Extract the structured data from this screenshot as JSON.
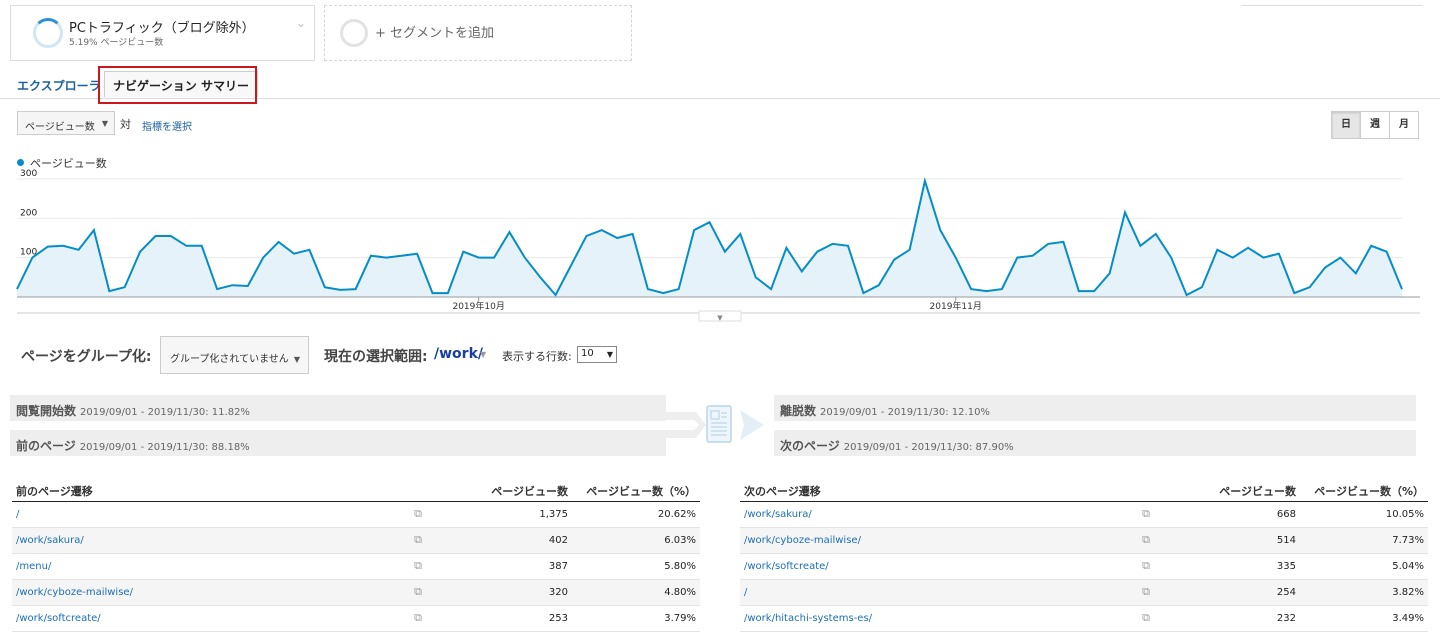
{
  "segments": {
    "active": {
      "title": "PCトラフィック（ブログ除外）",
      "subtitle": "5.19% ページビュー数"
    },
    "add_label": "+ セグメントを追加"
  },
  "tabs": {
    "explorer": "エクスプローラ",
    "navigation_summary": "ナビゲーション サマリー"
  },
  "metric_bar": {
    "selected_metric": "ページビュー数",
    "vs_label": "対",
    "choose_metric": "指標を選択",
    "period": {
      "day": "日",
      "week": "週",
      "month": "月",
      "active": "day"
    }
  },
  "chart_data": {
    "type": "area",
    "series": [
      {
        "name": "ページビュー数",
        "color": "#058dc7",
        "values": [
          20,
          100,
          128,
          130,
          120,
          170,
          15,
          25,
          115,
          155,
          155,
          130,
          130,
          20,
          30,
          28,
          100,
          140,
          110,
          120,
          25,
          18,
          20,
          105,
          100,
          105,
          110,
          10,
          10,
          115,
          100,
          100,
          165,
          100,
          50,
          5,
          80,
          155,
          170,
          150,
          160,
          20,
          10,
          20,
          170,
          190,
          115,
          160,
          50,
          20,
          125,
          65,
          115,
          135,
          130,
          10,
          30,
          95,
          120,
          295,
          170,
          100,
          20,
          15,
          20,
          100,
          105,
          135,
          140,
          15,
          15,
          60,
          215,
          130,
          160,
          100,
          5,
          25,
          120,
          100,
          125,
          100,
          110,
          10,
          25,
          75,
          100,
          60,
          130,
          115,
          20
        ]
      }
    ],
    "x_start": "2019-09-01",
    "x_end": "2019-11-30",
    "x_tick_labels": [
      "2019年10月",
      "2019年11月"
    ],
    "y_tick_labels": [
      "100",
      "200",
      "300"
    ],
    "ylim": [
      0,
      310
    ],
    "grid": true
  },
  "grouping": {
    "label": "ページをグループ化:",
    "select_value": "グループ化されていません",
    "selection_label": "現在の選択範囲:",
    "selection_path": "/work/",
    "rows_label": "表示する行数:",
    "rows_value": "10"
  },
  "flow": {
    "entrances": {
      "title": "閲覧開始数",
      "range": "2019/09/01 - 2019/11/30: 11.82%"
    },
    "previous": {
      "title": "前のページ",
      "range": "2019/09/01 - 2019/11/30: 88.18%"
    },
    "exits": {
      "title": "離脱数",
      "range": "2019/09/01 - 2019/11/30: 12.10%"
    },
    "next": {
      "title": "次のページ",
      "range": "2019/09/01 - 2019/11/30: 87.90%"
    }
  },
  "previous_table": {
    "headers": [
      "前のページ遷移",
      "ページビュー数",
      "ページビュー数（%）"
    ],
    "rows": [
      {
        "page": "/",
        "views": "1,375",
        "pct": "20.62%"
      },
      {
        "page": "/work/sakura/",
        "views": "402",
        "pct": "6.03%"
      },
      {
        "page": "/menu/",
        "views": "387",
        "pct": "5.80%"
      },
      {
        "page": "/work/cyboze-mailwise/",
        "views": "320",
        "pct": "4.80%"
      },
      {
        "page": "/work/softcreate/",
        "views": "253",
        "pct": "3.79%"
      }
    ]
  },
  "next_table": {
    "headers": [
      "次のページ遷移",
      "ページビュー数",
      "ページビュー数（%）"
    ],
    "rows": [
      {
        "page": "/work/sakura/",
        "views": "668",
        "pct": "10.05%"
      },
      {
        "page": "/work/cyboze-mailwise/",
        "views": "514",
        "pct": "7.73%"
      },
      {
        "page": "/work/softcreate/",
        "views": "335",
        "pct": "5.04%"
      },
      {
        "page": "/",
        "views": "254",
        "pct": "3.82%"
      },
      {
        "page": "/work/hitachi-systems-es/",
        "views": "232",
        "pct": "3.49%"
      }
    ]
  }
}
